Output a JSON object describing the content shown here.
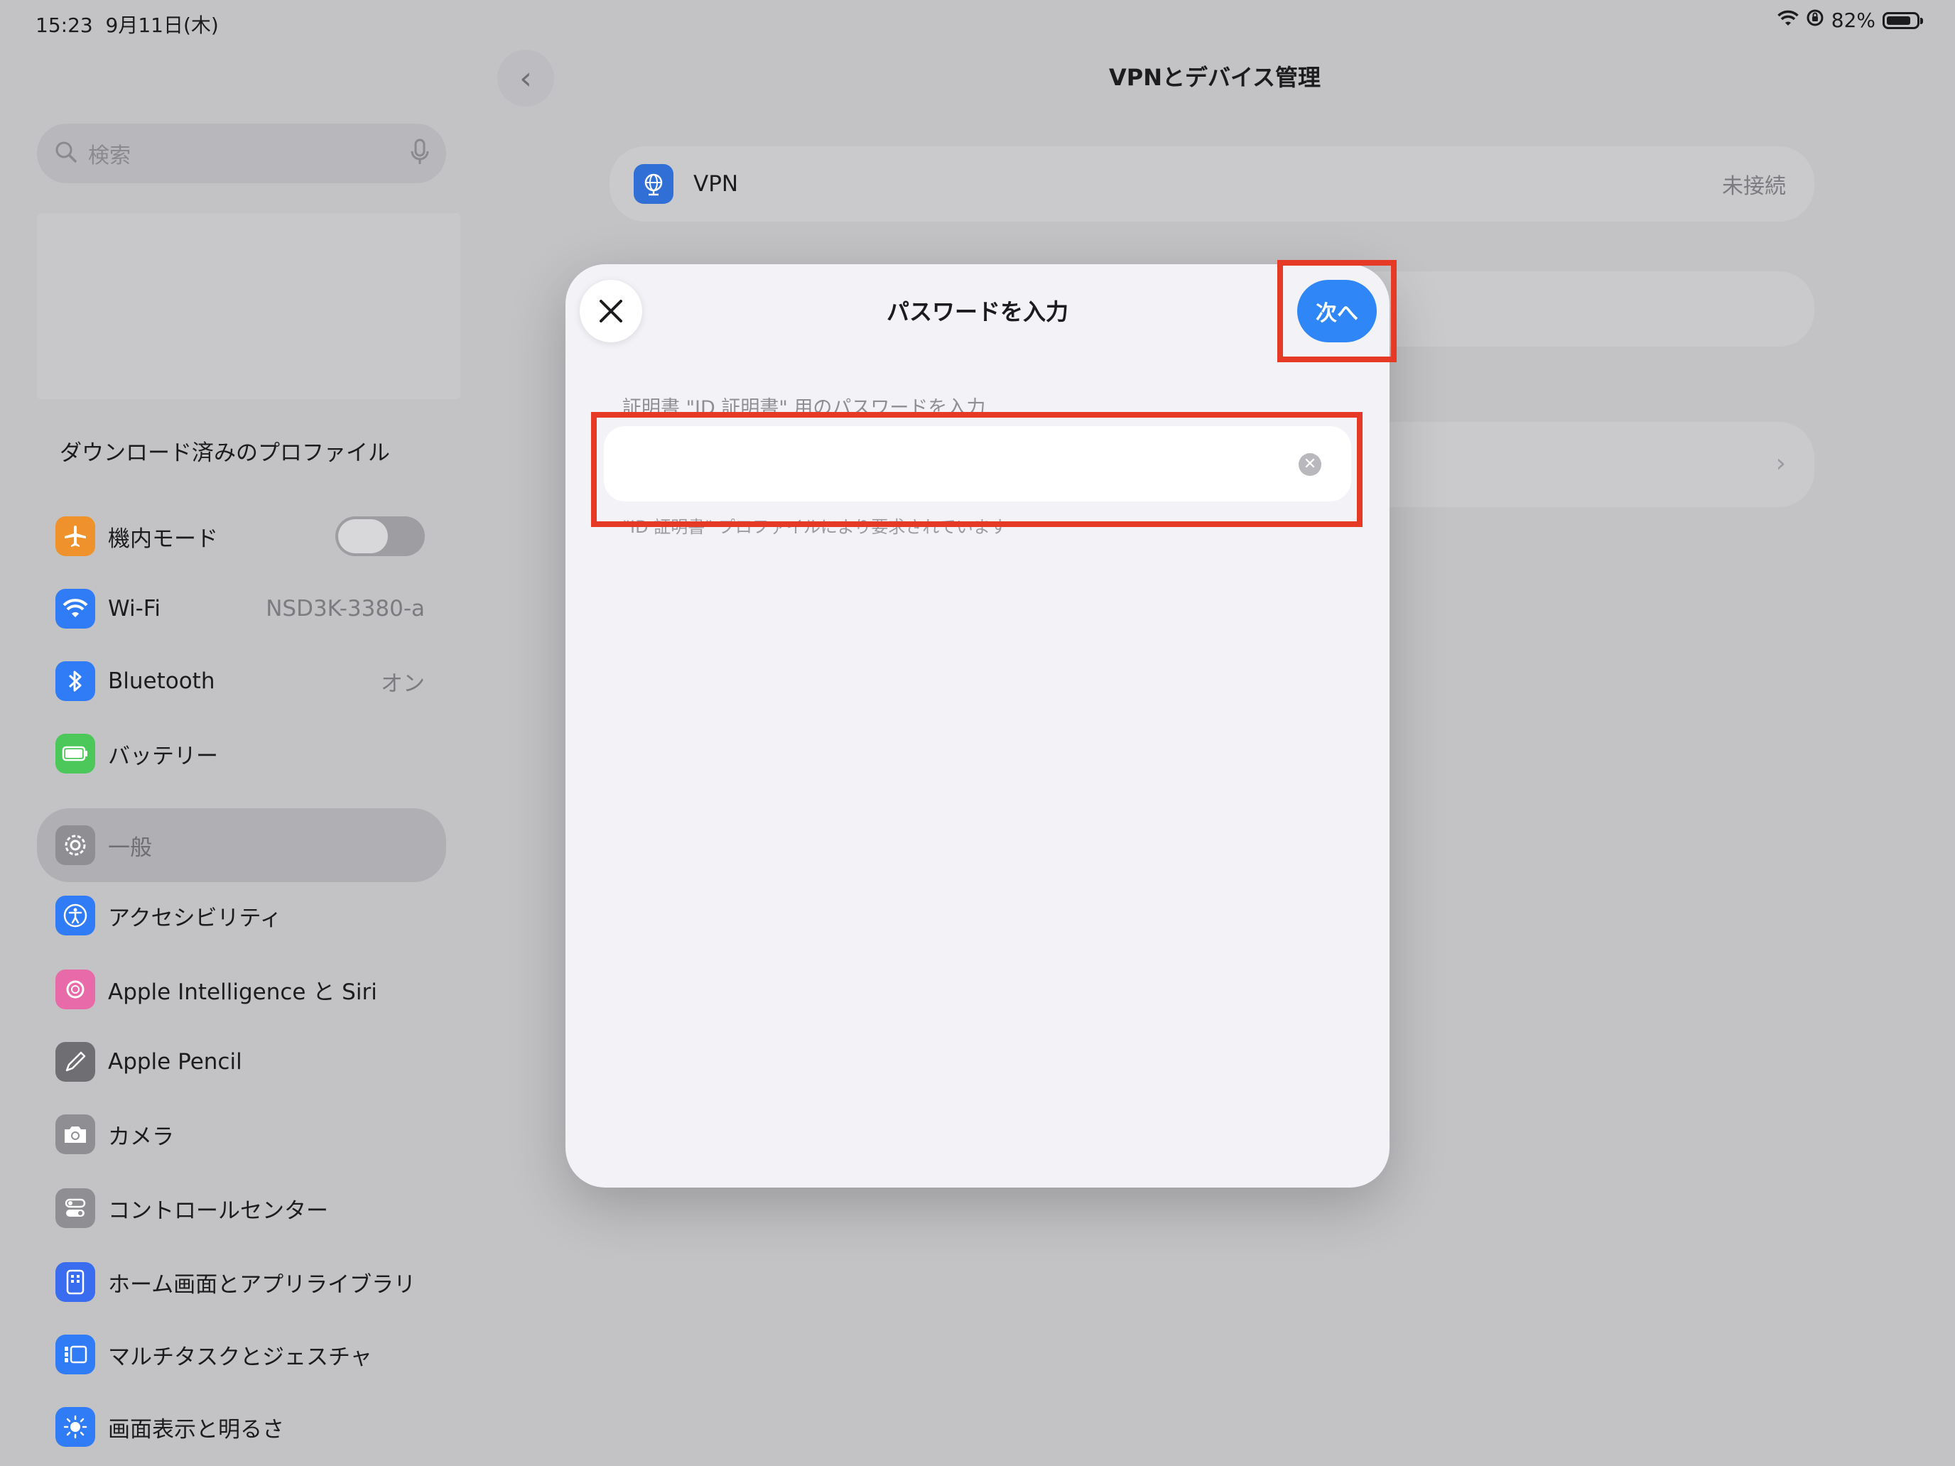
{
  "status_bar": {
    "time": "15:23",
    "date": "9月11日(木)",
    "battery": "82%",
    "battery_level": 0.82
  },
  "sidebar": {
    "search_placeholder": "検索",
    "profiles_label": "ダウンロード済みのプロファイル",
    "items": [
      {
        "label": "機内モード",
        "icon": "airplane-icon",
        "color": "#f0922b",
        "toggle": false
      },
      {
        "label": "Wi-Fi",
        "icon": "wifi-icon",
        "color": "#2f7cf6",
        "value": "NSD3K-3380-a"
      },
      {
        "label": "Bluetooth",
        "icon": "bluetooth-icon",
        "color": "#2f7cf6",
        "value": "オン"
      },
      {
        "label": "バッテリー",
        "icon": "battery-icon",
        "color": "#4cc85a"
      },
      {
        "label": "一般",
        "icon": "gear-icon",
        "color": "#8e8e93",
        "selected": true
      },
      {
        "label": "アクセシビリティ",
        "icon": "accessibility-icon",
        "color": "#2f7cf6"
      },
      {
        "label": "Apple Intelligence と Siri",
        "icon": "apple-intelligence-icon",
        "color": "#e96aa8"
      },
      {
        "label": "Apple Pencil",
        "icon": "pencil-icon",
        "color": "#6e6e73"
      },
      {
        "label": "カメラ",
        "icon": "camera-icon",
        "color": "#8e8e93"
      },
      {
        "label": "コントロールセンター",
        "icon": "control-center-icon",
        "color": "#8e8e93"
      },
      {
        "label": "ホーム画面とアプリライブラリ",
        "icon": "home-screen-icon",
        "color": "#3a6cf0"
      },
      {
        "label": "マルチタスクとジェスチャ",
        "icon": "multitask-icon",
        "color": "#2f7cf6"
      },
      {
        "label": "画面表示と明るさ",
        "icon": "brightness-icon",
        "color": "#2f7cf6"
      }
    ]
  },
  "main": {
    "title": "VPNとデバイス管理",
    "vpn": {
      "label": "VPN",
      "status": "未接続"
    }
  },
  "modal": {
    "title": "パスワードを入力",
    "next_label": "次へ",
    "field_header": "証明書 \"ID 証明書\" 用のパスワードを入力",
    "field_value": "",
    "field_footer": "\"ID 証明書\" プロファイルにより要求されています"
  },
  "colors": {
    "accent": "#2f86f6",
    "highlight": "#e63a27"
  }
}
